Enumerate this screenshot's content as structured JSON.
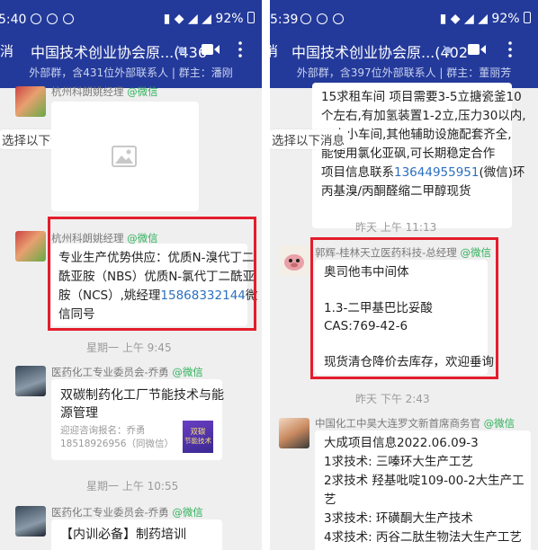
{
  "left": {
    "status": {
      "time": "5:40",
      "battery": "92%"
    },
    "title_bar": {
      "back": "消",
      "title": "中国技术创业协会原...(436"
    },
    "subtitle": "外部群，含431位外部联系人 | 群主：潘刚",
    "select_hint": "选择以下消息",
    "msg1": {
      "sender": "杭州科朗姚经理",
      "tag": "@微信"
    },
    "msg2": {
      "sender": "杭州科朗姚经理",
      "tag": "@微信",
      "lines": [
        "专业生产优势供应：优质N-溴代丁二",
        "酰亚胺（NBS）优质N-氯代丁二酰亚",
        "胺（NCS）,姚经理"
      ],
      "phone": "15868332144",
      "phone_suffix": "微",
      "last_line": "信同号"
    },
    "time1": "星期一 上午 9:45",
    "msg3": {
      "sender": "医药化工专业委员会-乔勇",
      "tag": "@微信",
      "title_lines": [
        "双碳制药化工厂节能技术与能",
        "源管理"
      ],
      "desc_lines": [
        "迎迎咨询报名：乔勇",
        "18518926956（同微信）"
      ],
      "thumb_lines": [
        "双碳",
        "节能技术"
      ]
    },
    "time2": "星期一 上午 10:55",
    "msg4": {
      "sender": "医药化工专业委员会-乔勇",
      "tag": "@微信",
      "text": "【内训必备】制药培训"
    }
  },
  "right": {
    "status": {
      "time": "5:39",
      "battery": "92%"
    },
    "title_bar": {
      "back": "消",
      "title": "中国技术创业协会原...(402"
    },
    "subtitle": "外部群，含397位外部联系人 | 群主：董丽芳",
    "select_hint": "选择以下消息",
    "msg0": {
      "lines": [
        "15求租车间 项目需要3-5立搪瓷釜10",
        "个左右,有加氢装置1-2立,压力30以内,",
        "立小车间,其他辅助设施配套齐全,",
        "能使用氯化亚砜,可长期稳定合作",
        "项目信息联系"
      ],
      "phone": "13644955951",
      "phone_suffix": "(微信)环",
      "last_line": "丙基溴/丙酮醛缩二甲醇现货"
    },
    "time1": "昨天 上午 11:13",
    "msg1": {
      "sender": "郭辉-桂林天立医药科技-总经理",
      "tag": "@微信",
      "lines": [
        "奥司他韦中间体",
        "",
        "1.3-二甲基巴比妥酸",
        "CAS:769-42-6",
        "",
        "现货清仓降价去库存，欢迎垂询"
      ]
    },
    "time2": "昨天 下午 2:43",
    "msg2": {
      "sender": "中国化工中昊大连罗文新首席商务官",
      "tag": "@微信",
      "lines": [
        "大成项目信息2022.06.09-3",
        "1求技术: 三嗪环大生产工艺",
        "2求技术 羟基吡啶109-00-2大生产工",
        "艺",
        "3求技术: 环磺酮大生产技术",
        "4求技术: 丙谷二肽生物法大生产工艺"
      ]
    }
  }
}
